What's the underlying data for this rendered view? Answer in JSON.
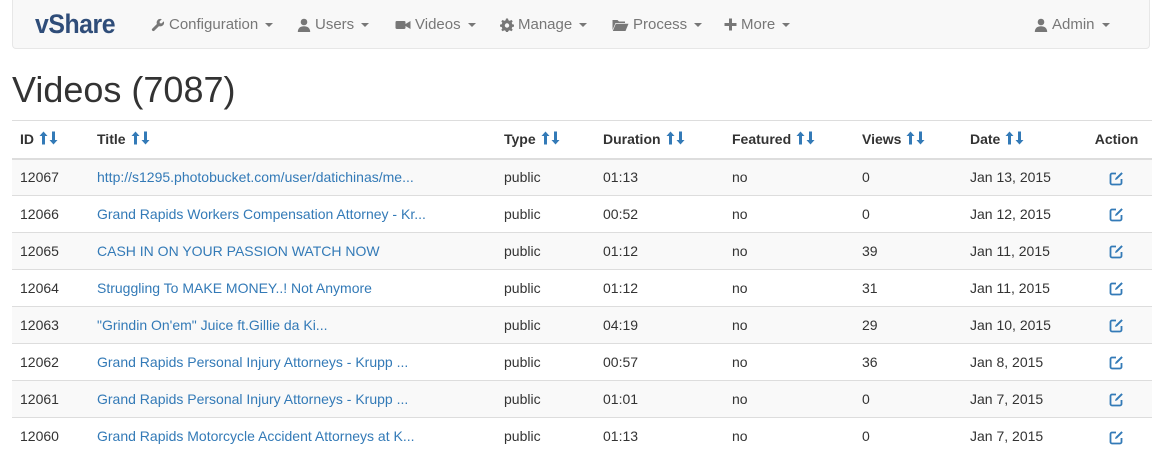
{
  "navbar": {
    "brand": "vShare",
    "menus": [
      {
        "label": "Configuration",
        "icon": "wrench-icon"
      },
      {
        "label": "Users",
        "icon": "user-icon"
      },
      {
        "label": "Videos",
        "icon": "video-camera-icon"
      },
      {
        "label": "Manage",
        "icon": "gear-icon"
      },
      {
        "label": "Process",
        "icon": "folder-open-icon"
      },
      {
        "label": "More",
        "icon": "plus-icon"
      }
    ],
    "account": {
      "label": "Admin",
      "icon": "user-icon"
    }
  },
  "page": {
    "title": "Videos (7087)"
  },
  "table": {
    "columns": {
      "id": "ID",
      "title": "Title",
      "type": "Type",
      "duration": "Duration",
      "featured": "Featured",
      "views": "Views",
      "date": "Date",
      "action": "Action"
    },
    "rows": [
      {
        "id": "12067",
        "title": "http://s1295.photobucket.com/user/datichinas/me...",
        "type": "public",
        "duration": "01:13",
        "featured": "no",
        "views": "0",
        "date": "Jan 13, 2015"
      },
      {
        "id": "12066",
        "title": "Grand Rapids Workers Compensation Attorney - Kr...",
        "type": "public",
        "duration": "00:52",
        "featured": "no",
        "views": "0",
        "date": "Jan 12, 2015"
      },
      {
        "id": "12065",
        "title": "CASH IN ON YOUR PASSION WATCH NOW",
        "type": "public",
        "duration": "01:12",
        "featured": "no",
        "views": "39",
        "date": "Jan 11, 2015"
      },
      {
        "id": "12064",
        "title": "Struggling To MAKE MONEY..! Not Anymore",
        "type": "public",
        "duration": "01:12",
        "featured": "no",
        "views": "31",
        "date": "Jan 11, 2015"
      },
      {
        "id": "12063",
        "title": "\"Grindin On'em\" Juice ft.Gillie da Ki...",
        "type": "public",
        "duration": "04:19",
        "featured": "no",
        "views": "29",
        "date": "Jan 10, 2015"
      },
      {
        "id": "12062",
        "title": "Grand Rapids Personal Injury Attorneys - Krupp ...",
        "type": "public",
        "duration": "00:57",
        "featured": "no",
        "views": "36",
        "date": "Jan 8, 2015"
      },
      {
        "id": "12061",
        "title": "Grand Rapids Personal Injury Attorneys - Krupp ...",
        "type": "public",
        "duration": "01:01",
        "featured": "no",
        "views": "0",
        "date": "Jan 7, 2015"
      },
      {
        "id": "12060",
        "title": "Grand Rapids Motorcycle Accident Attorneys at K...",
        "type": "public",
        "duration": "01:13",
        "featured": "no",
        "views": "0",
        "date": "Jan 7, 2015"
      }
    ]
  },
  "colors": {
    "link": "#337ab7",
    "brand": "#2f4d79",
    "nav_text": "#777777",
    "sort_arrow": "#337ab7"
  }
}
